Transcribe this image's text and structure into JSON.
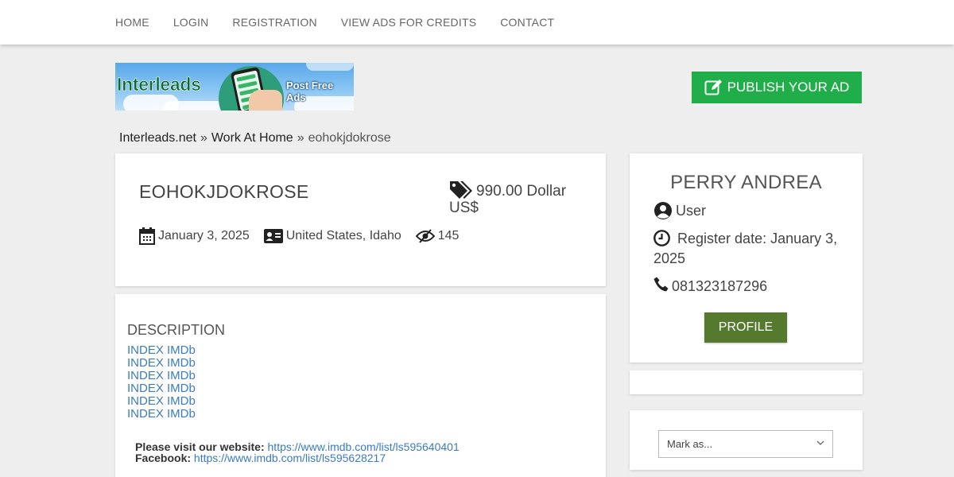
{
  "nav": {
    "items": [
      {
        "label": "HOME"
      },
      {
        "label": "LOGIN"
      },
      {
        "label": "REGISTRATION"
      },
      {
        "label": "VIEW ADS FOR CREDITS"
      },
      {
        "label": "CONTACT"
      }
    ]
  },
  "banner": {
    "brand": "Interleads",
    "tagline": "Post Free Ads",
    "icon": "phone-in-hand-illustration"
  },
  "publish": {
    "label": "PUBLISH YOUR AD",
    "icon": "edit-icon"
  },
  "breadcrumb": {
    "items": [
      "Interleads.net",
      "Work At Home",
      "eohokjdokrose"
    ],
    "separator": "»"
  },
  "ad": {
    "title": "EOHOKJDOKROSE",
    "price": "990.00 Dollar US$",
    "date": "January 3, 2025",
    "location": "United States, Idaho",
    "views": "145"
  },
  "description": {
    "heading": "DESCRIPTION",
    "links": [
      "INDEX IMDb",
      "INDEX IMDb",
      "INDEX IMDb",
      "INDEX IMDb",
      "INDEX IMDb",
      "INDEX IMDb"
    ],
    "website_label": "Please visit our website:",
    "website_url": "https://www.imdb.com/list/ls595640401",
    "facebook_label": "Facebook:",
    "facebook_url": "https://www.imdb.com/list/ls595628217"
  },
  "user": {
    "name": "PERRY ANDREA",
    "role": "User",
    "register_date": "Register date: January 3, 2025",
    "phone": "081323187296",
    "profile_label": "PROFILE"
  },
  "mark": {
    "selected": "Mark as..."
  },
  "colors": {
    "publish_green": "#1fae49",
    "profile_green": "#557a2e",
    "link_blue": "#3a7bbf",
    "page_bg": "#eeeeee"
  }
}
